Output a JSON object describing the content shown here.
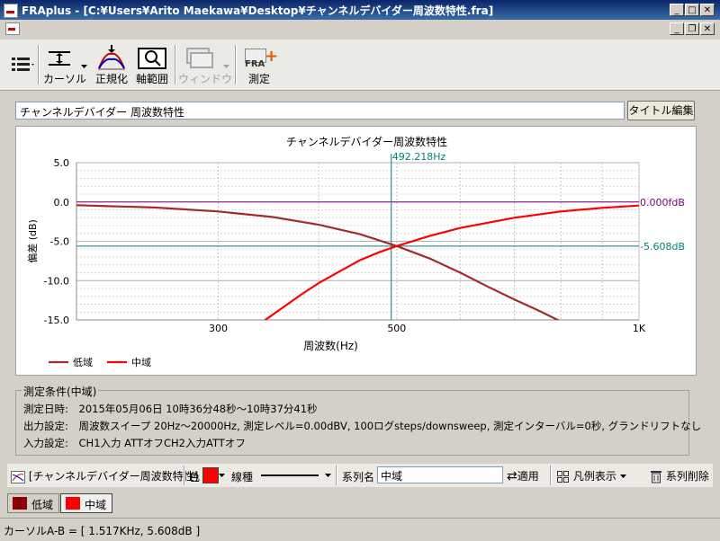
{
  "window": {
    "title": "FRAplus - [C:¥Users¥Arito Maekawa¥Desktop¥チャンネルデバイダー周波数特性.fra]"
  },
  "toolbar": {
    "cursor_label": "カーソル",
    "normalize_label": "正規化",
    "axis_range_label": "軸範囲",
    "window_label": "ウィンドウ",
    "measure_label": "測定",
    "measure_icon_text": "FRA"
  },
  "title_field": {
    "value": "チャンネルデバイダー 周波数特性"
  },
  "title_edit_button": "タイトル編集",
  "chart_data": {
    "type": "line",
    "title": "チャンネルデバイダー周波数特性",
    "xlabel": "周波数(Hz)",
    "ylabel": "偏差 (dB)",
    "xscale": "log",
    "xlim": [
      200,
      1000
    ],
    "ylim": [
      -15,
      5
    ],
    "yticks": [
      "5.0",
      "0.0",
      "-5.0",
      "-10.0",
      "-15.0"
    ],
    "xticks": [
      "300",
      "500",
      "1K"
    ],
    "grid": true,
    "legend_position": "bottom-left",
    "series": [
      {
        "name": "低域",
        "color": "#a52a2a",
        "x": [
          200,
          250,
          300,
          350,
          400,
          450,
          500,
          550,
          600,
          650,
          700,
          750,
          800,
          850
        ],
        "y": [
          -0.4,
          -0.7,
          -1.2,
          -1.9,
          -2.9,
          -4.1,
          -5.6,
          -7.2,
          -9.0,
          -10.8,
          -12.4,
          -13.8,
          -15.2,
          -16.5
        ]
      },
      {
        "name": "中域",
        "color": "#ff0000",
        "x": [
          340,
          360,
          380,
          400,
          425,
          450,
          475,
          500,
          550,
          600,
          700,
          800,
          900,
          1000
        ],
        "y": [
          -15.3,
          -13.5,
          -11.8,
          -10.3,
          -8.8,
          -7.4,
          -6.4,
          -5.6,
          -4.3,
          -3.3,
          -2.0,
          -1.2,
          -0.75,
          -0.45
        ]
      }
    ],
    "cursor_x": {
      "value": 492.218,
      "label": "492.218Hz"
    },
    "cursor_lines": [
      {
        "value": 0.0,
        "label": "0.000fdB",
        "color": "#800080"
      },
      {
        "value": -5.608,
        "label": "-5.608dB",
        "color": "#008080"
      }
    ]
  },
  "conditions": {
    "title": "測定条件(中域)",
    "date_label": "測定日時:",
    "date_value": "2015年05月06日 10時36分48秒～10時37分41秒",
    "output_label": "出力設定:",
    "output_value": "周波数スイープ 20Hz～20000Hz, 測定レベル=0.00dBV, 100ログsteps/downsweep, 測定インターバル=0秒, グランドリフトなし",
    "input_label": "入力設定:",
    "input_value": "CH1入力 ATTオフCH2入力ATTオフ"
  },
  "bottom_toolbar": {
    "chart_name": "[チャンネルデバイダー周波数特性]",
    "color_label": "色",
    "color_value": "#ff0000",
    "linetype_label": "線種",
    "series_name_label": "系列名",
    "series_name_value": "中域",
    "apply_label": "適用",
    "legend_label": "凡例表示",
    "delete_label": "系列削除"
  },
  "series_tabs": [
    {
      "label": "低域",
      "color": "#8b0000"
    },
    {
      "label": "中域",
      "color": "#ff0000"
    }
  ],
  "status": {
    "text": "カーソルA-B = [ 1.517KHz, 5.608dB ]"
  }
}
